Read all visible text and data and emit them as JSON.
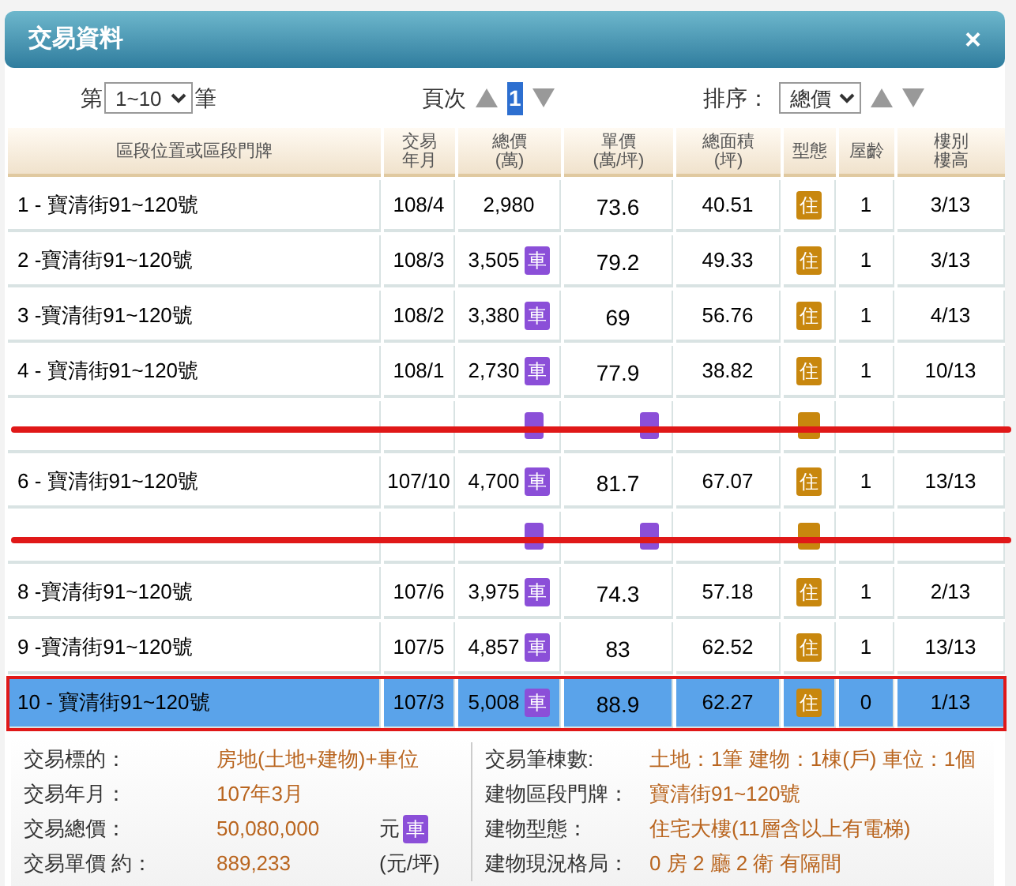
{
  "window": {
    "title": "交易資料",
    "close": "×"
  },
  "toolbar": {
    "range_prefix": "第",
    "range_value": "1~10",
    "range_suffix": "筆",
    "page_label": "頁次",
    "page": "1",
    "sort_label": "排序：",
    "sort_value": "總價"
  },
  "table": {
    "columns": [
      {
        "lines": [
          "區段位置或區段門牌"
        ]
      },
      {
        "lines": [
          "交易",
          "年月"
        ]
      },
      {
        "lines": [
          "總價",
          "(萬)"
        ]
      },
      {
        "lines": [
          "單價",
          "(萬/坪)"
        ]
      },
      {
        "lines": [
          "總面積",
          "(坪)"
        ]
      },
      {
        "lines": [
          "型態"
        ]
      },
      {
        "lines": [
          "屋齡"
        ]
      },
      {
        "lines": [
          "樓別",
          "樓高"
        ]
      }
    ],
    "rows": [
      {
        "label": "1 - 寶清街91~120號",
        "date": "108/4",
        "total": "2,980",
        "unit": "73.6",
        "area": "40.51",
        "type": "住",
        "age": "1",
        "floor": "3/13",
        "selected": false,
        "struck": false
      },
      {
        "label": "2 -寶清街91~120號",
        "date": "108/3",
        "total": "3,505",
        "total_badge": "車",
        "unit": "79.2",
        "area": "49.33",
        "type": "住",
        "age": "1",
        "floor": "3/13",
        "selected": false,
        "struck": false
      },
      {
        "label": "3 -寶清街91~120號",
        "date": "108/2",
        "total": "3,380",
        "total_badge": "車",
        "unit": "69",
        "area": "56.76",
        "type": "住",
        "age": "1",
        "floor": "4/13",
        "selected": false,
        "struck": false
      },
      {
        "label": "4 - 寶清街91~120號",
        "date": "108/1",
        "total": "2,730",
        "total_badge": "車",
        "unit": "77.9",
        "area": "38.82",
        "type": "住",
        "age": "1",
        "floor": "10/13",
        "selected": false,
        "struck": false
      },
      {
        "car_total": true,
        "car_unit": true,
        "residential": true,
        "selected": false,
        "struck": true
      },
      {
        "label": "6 - 寶清街91~120號",
        "date": "107/10",
        "total": "4,700",
        "total_badge": "車",
        "unit": "81.7",
        "area": "67.07",
        "type": "住",
        "age": "1",
        "floor": "13/13",
        "selected": false,
        "struck": false
      },
      {
        "car_total": true,
        "car_unit": true,
        "residential": true,
        "selected": false,
        "struck": true
      },
      {
        "label": "8 -寶清街91~120號",
        "date": "107/6",
        "total": "3,975",
        "total_badge": "車",
        "unit": "74.3",
        "area": "57.18",
        "type": "住",
        "age": "1",
        "floor": "2/13",
        "selected": false,
        "struck": false
      },
      {
        "label": "9 -寶清街91~120號",
        "date": "107/5",
        "total": "4,857",
        "total_badge": "車",
        "unit": "83",
        "area": "62.52",
        "type": "住",
        "age": "1",
        "floor": "13/13",
        "selected": false,
        "struck": false
      },
      {
        "label": "10 - 寶清街91~120號",
        "date": "107/3",
        "total": "5,008",
        "total_badge": "車",
        "unit": "88.9",
        "area": "62.27",
        "type": "住",
        "age": "0",
        "floor": "1/13",
        "selected": true,
        "struck": false
      }
    ]
  },
  "details": {
    "left": [
      {
        "label": "交易標的：",
        "value": "房地(土地+建物)+車位"
      },
      {
        "label": "交易年月：",
        "value": "107年3月"
      },
      {
        "label": "交易總價：",
        "value": "50,080,000",
        "unit": "元",
        "badge": "車"
      },
      {
        "label": "交易單價 約：",
        "value": "889,233",
        "unit": "(元/坪)"
      }
    ],
    "right": [
      {
        "label": "交易筆棟數:",
        "value": "土地：1筆 建物：1棟(戶) 車位：1個"
      },
      {
        "label": "建物區段門牌：",
        "value": "寶清街91~120號"
      },
      {
        "label": "建物型態：",
        "value": "住宅大樓(11層含以上有電梯)"
      },
      {
        "label": "建物現況格局：",
        "value": "0 房 2 廳 2 衛 有隔間"
      }
    ]
  }
}
